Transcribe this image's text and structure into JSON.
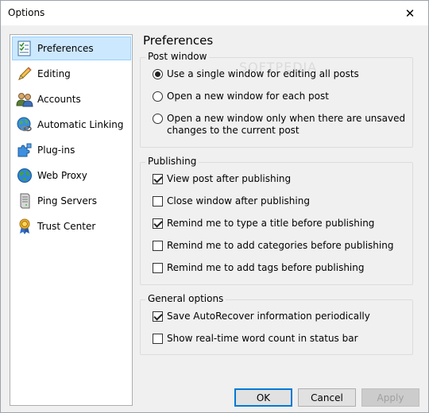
{
  "window": {
    "title": "Options",
    "close_glyph": "✕"
  },
  "sidebar": {
    "items": [
      {
        "label": "Preferences",
        "icon": "preferences-checklist-icon",
        "selected": true
      },
      {
        "label": "Editing",
        "icon": "pencil-icon"
      },
      {
        "label": "Accounts",
        "icon": "users-icon"
      },
      {
        "label": "Automatic Linking",
        "icon": "globe-link-icon"
      },
      {
        "label": "Plug-ins",
        "icon": "puzzle-icon"
      },
      {
        "label": "Web Proxy",
        "icon": "globe-icon"
      },
      {
        "label": "Ping Servers",
        "icon": "server-icon"
      },
      {
        "label": "Trust Center",
        "icon": "ribbon-award-icon"
      }
    ]
  },
  "page": {
    "title": "Preferences"
  },
  "post_window": {
    "legend": "Post window",
    "options": [
      {
        "label": "Use a single window for editing all posts",
        "selected": true
      },
      {
        "label": "Open a new window for each post",
        "selected": false
      },
      {
        "label_line1": "Open a new window only when there are unsaved",
        "label_line2": "changes to the current post",
        "selected": false
      }
    ]
  },
  "publishing": {
    "legend": "Publishing",
    "options": [
      {
        "label": "View post after publishing",
        "checked": true
      },
      {
        "label": "Close window after publishing",
        "checked": false
      },
      {
        "label": "Remind me to type a title before publishing",
        "checked": true
      },
      {
        "label": "Remind me to add categories before publishing",
        "checked": false
      },
      {
        "label": "Remind me to add tags before publishing",
        "checked": false
      }
    ]
  },
  "general": {
    "legend": "General options",
    "options": [
      {
        "label": "Save AutoRecover information periodically",
        "checked": true
      },
      {
        "label": "Show real-time word count in status bar",
        "checked": false
      }
    ]
  },
  "buttons": {
    "ok": "OK",
    "cancel": "Cancel",
    "apply": "Apply"
  },
  "watermark": "SOFTPEDIA",
  "colors": {
    "selection": "#cce8ff",
    "selection_border": "#99d1ff",
    "default_button_border": "#0078d7"
  }
}
